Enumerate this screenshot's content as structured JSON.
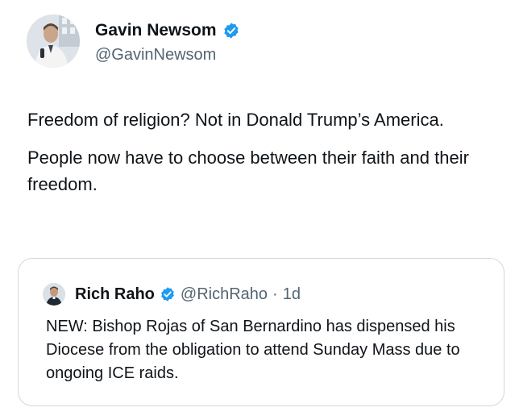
{
  "tweet": {
    "author_name": "Gavin Newsom",
    "author_handle": "@GavinNewsom",
    "paragraphs": [
      "Freedom of religion? Not in Donald Trump’s America.",
      "People now have to choose between their faith and their freedom."
    ],
    "verified_icon": "verified-badge-icon"
  },
  "quote": {
    "author_name": "Rich Raho",
    "author_handle": "@RichRaho",
    "separator": "·",
    "time": "1d",
    "text": "NEW: Bishop Rojas of San Bernardino has dispensed his Diocese from the obligation to attend Sunday Mass due to ongoing ICE raids."
  },
  "colors": {
    "text": "#0f1419",
    "secondary": "#536471",
    "verified": "#1d9bf0",
    "border": "#cfd9de"
  }
}
